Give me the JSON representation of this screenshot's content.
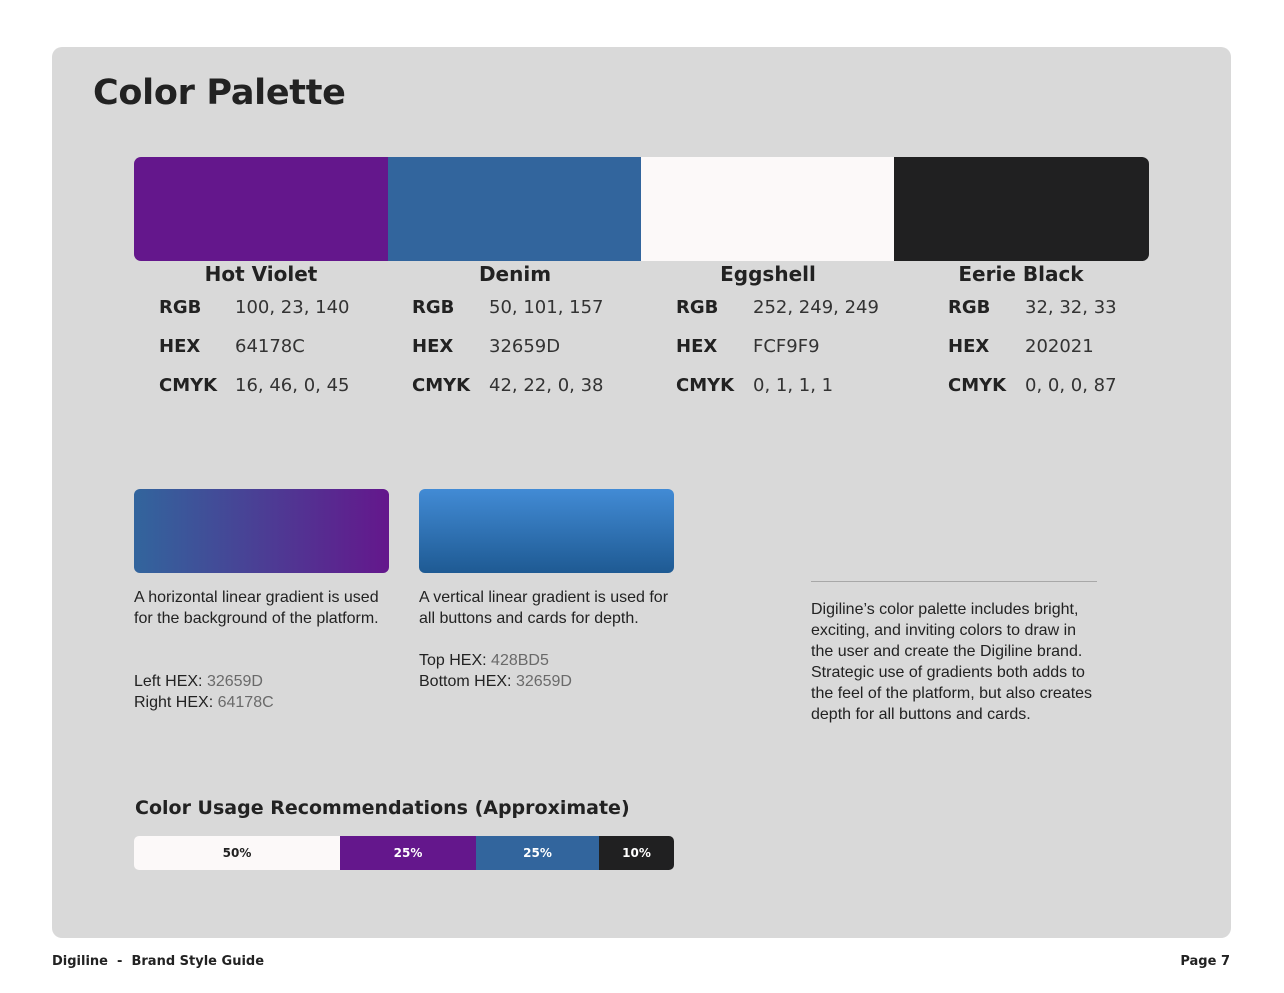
{
  "page": {
    "title": "Color Palette"
  },
  "colors": [
    {
      "name": "Hot Violet",
      "hex_color": "#64178C",
      "rgb": "100, 23, 140",
      "hex": "64178C",
      "cmyk": "16, 46, 0, 45"
    },
    {
      "name": "Denim",
      "hex_color": "#32659D",
      "rgb": "50, 101, 157",
      "hex": "32659D",
      "cmyk": "42, 22, 0, 38"
    },
    {
      "name": "Eggshell",
      "hex_color": "#FCF9F9",
      "rgb": "252, 249, 249",
      "hex": "FCF9F9",
      "cmyk": "0, 1, 1, 1"
    },
    {
      "name": "Eerie Black",
      "hex_color": "#202021",
      "rgb": "32, 32, 33",
      "hex": "202021",
      "cmyk": "0, 0, 0, 87"
    }
  ],
  "labels": {
    "rgb": "RGB",
    "hex": "HEX",
    "cmyk": "CMYK"
  },
  "gradients": {
    "horizontal": {
      "description": "A horizontal linear gradient is used for the background of the platform.",
      "left_label": "Left HEX:",
      "left_value": "32659D",
      "right_label": "Right HEX:",
      "right_value": "64178C",
      "from_color": "#32659D",
      "to_color": "#64178C"
    },
    "vertical": {
      "description": "A vertical linear gradient is used for all buttons and cards for depth.",
      "top_label": "Top HEX:",
      "top_value": "428BD5",
      "bottom_label": "Bottom HEX:",
      "bottom_value": "32659D",
      "from_color": "#428BD5",
      "to_color": "#1E5A93"
    }
  },
  "summary": "Digiline’s color palette includes bright, exciting, and inviting colors to draw in the user and create the Digiline brand. Strategic use of gradients both adds to the feel of the platform, but also creates depth for all buttons and cards.",
  "usage": {
    "title": "Color Usage Recommendations (Approximate)",
    "segments": [
      {
        "label": "50%",
        "color": "#FCF9F9",
        "text_color": "#222222"
      },
      {
        "label": "25%",
        "color": "#64178C",
        "text_color": "#FFFFFF"
      },
      {
        "label": "25%",
        "color": "#32659D",
        "text_color": "#FFFFFF"
      },
      {
        "label": "10%",
        "color": "#202021",
        "text_color": "#FFFFFF"
      }
    ]
  },
  "footer": {
    "left": "Digiline  -  Brand Style Guide",
    "right": "Page 7"
  }
}
